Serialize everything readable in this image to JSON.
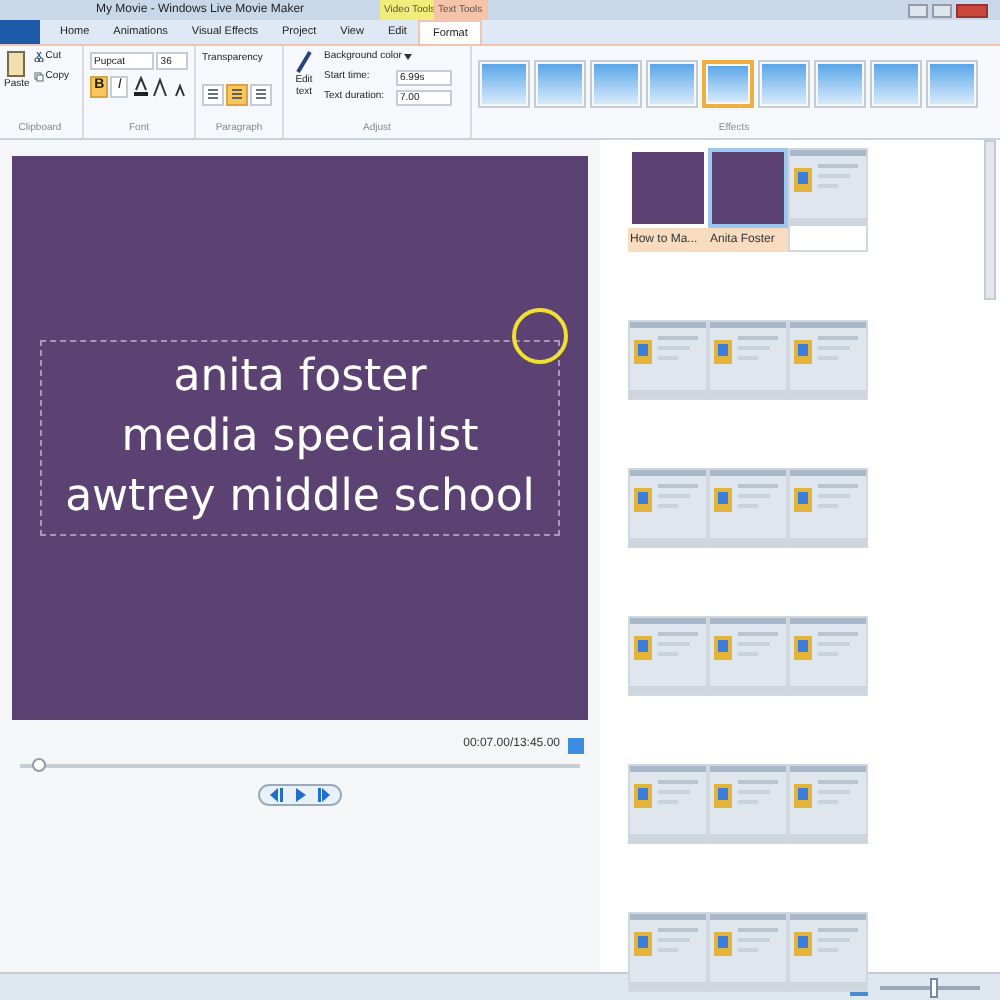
{
  "window": {
    "title": "My Movie - Windows Live Movie Maker"
  },
  "context_tabs": [
    {
      "label": "Video Tools",
      "color": "#f2ec7a"
    },
    {
      "label": "Text Tools",
      "color": "#f5c3a8"
    }
  ],
  "tabs": [
    {
      "label": "Home",
      "selected": false
    },
    {
      "label": "Animations",
      "selected": false
    },
    {
      "label": "Visual Effects",
      "selected": false
    },
    {
      "label": "Project",
      "selected": false
    },
    {
      "label": "View",
      "selected": false
    },
    {
      "label": "Edit",
      "selected": false
    },
    {
      "label": "Format",
      "selected": true
    }
  ],
  "clipboard": {
    "paste": "Paste",
    "cut": "Cut",
    "copy": "Copy",
    "group": "Clipboard"
  },
  "font": {
    "name": "Pupcat",
    "size": "36",
    "bold": true,
    "bold_key": "B",
    "italic": false,
    "italic_key": "I",
    "group": "Font"
  },
  "transparency": "Transparency",
  "paragraph": {
    "align": [
      {
        "selected": false
      },
      {
        "selected": true
      },
      {
        "selected": false
      }
    ],
    "group": "Paragraph"
  },
  "adjust": {
    "edit_text": "Edit text",
    "background_color": "Background color",
    "start_time_label": "Start time:",
    "start_time": "6.99s",
    "duration_label": "Text duration:",
    "duration": "7.00",
    "group": "Adjust"
  },
  "effects": {
    "group": "Effects",
    "items": [
      {
        "selected": false
      },
      {
        "selected": false
      },
      {
        "selected": false
      },
      {
        "selected": false
      },
      {
        "selected": true
      },
      {
        "selected": false
      },
      {
        "selected": false
      },
      {
        "selected": false
      },
      {
        "selected": false
      }
    ]
  },
  "preview": {
    "lines": [
      "anita foster",
      "media specialist",
      "awtrey middle school"
    ],
    "time": "00:07.00/13:45.00",
    "level": 0.02
  },
  "storyboard": [
    [
      {
        "kind": "title",
        "caption": "How to Ma...",
        "selected": false
      },
      {
        "kind": "title",
        "caption": "Anita Foster",
        "selected": true
      },
      {
        "kind": "video",
        "selected": false
      }
    ],
    [
      {
        "kind": "video",
        "selected": false
      },
      {
        "kind": "video",
        "selected": false
      },
      {
        "kind": "video",
        "selected": false
      }
    ],
    [
      {
        "kind": "video",
        "selected": false
      },
      {
        "kind": "video",
        "selected": false
      },
      {
        "kind": "video",
        "selected": false
      }
    ],
    [
      {
        "kind": "video",
        "selected": false
      },
      {
        "kind": "video",
        "selected": false
      },
      {
        "kind": "video",
        "selected": false
      }
    ],
    [
      {
        "kind": "video",
        "selected": false
      },
      {
        "kind": "video",
        "selected": false
      },
      {
        "kind": "video",
        "selected": false
      }
    ],
    [
      {
        "kind": "video",
        "selected": false
      },
      {
        "kind": "video",
        "selected": false
      },
      {
        "kind": "video",
        "selected": false
      }
    ]
  ],
  "zoom": {
    "level": 0.5
  }
}
